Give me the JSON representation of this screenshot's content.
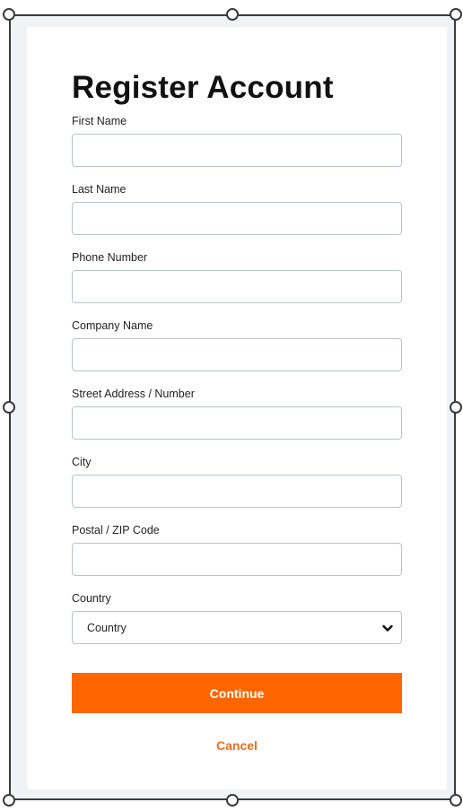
{
  "form": {
    "title": "Register Account",
    "fields": [
      {
        "label": "First Name",
        "value": "",
        "placeholder": ""
      },
      {
        "label": "Last Name",
        "value": "",
        "placeholder": ""
      },
      {
        "label": "Phone Number",
        "value": "",
        "placeholder": ""
      },
      {
        "label": "Company Name",
        "value": "",
        "placeholder": ""
      },
      {
        "label": "Street Address / Number",
        "value": "",
        "placeholder": ""
      },
      {
        "label": "City",
        "value": "",
        "placeholder": ""
      },
      {
        "label": "Postal / ZIP Code",
        "value": "",
        "placeholder": ""
      }
    ],
    "country": {
      "label": "Country",
      "selected": "Country"
    },
    "continue_label": "Continue",
    "cancel_label": "Cancel"
  },
  "colors": {
    "accent": "#ff6600",
    "cancel": "#f26a1b",
    "input_border": "#b9c2cf",
    "frame_background": "#f1f2f5"
  },
  "icons": {
    "select_arrow": "chevron-down-icon",
    "selection_handles": "resize-handle-icon"
  }
}
